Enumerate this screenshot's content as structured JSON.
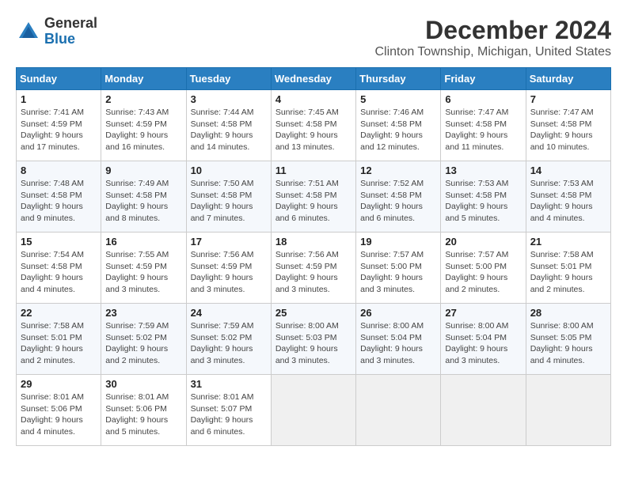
{
  "header": {
    "logo_general": "General",
    "logo_blue": "Blue",
    "month_title": "December 2024",
    "location": "Clinton Township, Michigan, United States"
  },
  "calendar": {
    "days_of_week": [
      "Sunday",
      "Monday",
      "Tuesday",
      "Wednesday",
      "Thursday",
      "Friday",
      "Saturday"
    ],
    "weeks": [
      [
        null,
        null,
        null,
        null,
        null,
        null,
        null
      ]
    ],
    "cells": [
      {
        "day": null,
        "week": 0,
        "dow": 0
      },
      {
        "day": null,
        "week": 0,
        "dow": 1
      },
      {
        "day": null,
        "week": 0,
        "dow": 2
      },
      {
        "day": null,
        "week": 0,
        "dow": 3
      },
      {
        "day": null,
        "week": 0,
        "dow": 4
      },
      {
        "day": null,
        "week": 0,
        "dow": 5
      },
      {
        "day": null,
        "week": 0,
        "dow": 6
      }
    ]
  },
  "days": [
    {
      "num": "1",
      "sunrise": "7:41 AM",
      "sunset": "4:59 PM",
      "daylight": "9 hours and 17 minutes."
    },
    {
      "num": "2",
      "sunrise": "7:43 AM",
      "sunset": "4:59 PM",
      "daylight": "9 hours and 16 minutes."
    },
    {
      "num": "3",
      "sunrise": "7:44 AM",
      "sunset": "4:58 PM",
      "daylight": "9 hours and 14 minutes."
    },
    {
      "num": "4",
      "sunrise": "7:45 AM",
      "sunset": "4:58 PM",
      "daylight": "9 hours and 13 minutes."
    },
    {
      "num": "5",
      "sunrise": "7:46 AM",
      "sunset": "4:58 PM",
      "daylight": "9 hours and 12 minutes."
    },
    {
      "num": "6",
      "sunrise": "7:47 AM",
      "sunset": "4:58 PM",
      "daylight": "9 hours and 11 minutes."
    },
    {
      "num": "7",
      "sunrise": "7:47 AM",
      "sunset": "4:58 PM",
      "daylight": "9 hours and 10 minutes."
    },
    {
      "num": "8",
      "sunrise": "7:48 AM",
      "sunset": "4:58 PM",
      "daylight": "9 hours and 9 minutes."
    },
    {
      "num": "9",
      "sunrise": "7:49 AM",
      "sunset": "4:58 PM",
      "daylight": "9 hours and 8 minutes."
    },
    {
      "num": "10",
      "sunrise": "7:50 AM",
      "sunset": "4:58 PM",
      "daylight": "9 hours and 7 minutes."
    },
    {
      "num": "11",
      "sunrise": "7:51 AM",
      "sunset": "4:58 PM",
      "daylight": "9 hours and 6 minutes."
    },
    {
      "num": "12",
      "sunrise": "7:52 AM",
      "sunset": "4:58 PM",
      "daylight": "9 hours and 6 minutes."
    },
    {
      "num": "13",
      "sunrise": "7:53 AM",
      "sunset": "4:58 PM",
      "daylight": "9 hours and 5 minutes."
    },
    {
      "num": "14",
      "sunrise": "7:53 AM",
      "sunset": "4:58 PM",
      "daylight": "9 hours and 4 minutes."
    },
    {
      "num": "15",
      "sunrise": "7:54 AM",
      "sunset": "4:58 PM",
      "daylight": "9 hours and 4 minutes."
    },
    {
      "num": "16",
      "sunrise": "7:55 AM",
      "sunset": "4:59 PM",
      "daylight": "9 hours and 3 minutes."
    },
    {
      "num": "17",
      "sunrise": "7:56 AM",
      "sunset": "4:59 PM",
      "daylight": "9 hours and 3 minutes."
    },
    {
      "num": "18",
      "sunrise": "7:56 AM",
      "sunset": "4:59 PM",
      "daylight": "9 hours and 3 minutes."
    },
    {
      "num": "19",
      "sunrise": "7:57 AM",
      "sunset": "5:00 PM",
      "daylight": "9 hours and 3 minutes."
    },
    {
      "num": "20",
      "sunrise": "7:57 AM",
      "sunset": "5:00 PM",
      "daylight": "9 hours and 2 minutes."
    },
    {
      "num": "21",
      "sunrise": "7:58 AM",
      "sunset": "5:01 PM",
      "daylight": "9 hours and 2 minutes."
    },
    {
      "num": "22",
      "sunrise": "7:58 AM",
      "sunset": "5:01 PM",
      "daylight": "9 hours and 2 minutes."
    },
    {
      "num": "23",
      "sunrise": "7:59 AM",
      "sunset": "5:02 PM",
      "daylight": "9 hours and 2 minutes."
    },
    {
      "num": "24",
      "sunrise": "7:59 AM",
      "sunset": "5:02 PM",
      "daylight": "9 hours and 3 minutes."
    },
    {
      "num": "25",
      "sunrise": "8:00 AM",
      "sunset": "5:03 PM",
      "daylight": "9 hours and 3 minutes."
    },
    {
      "num": "26",
      "sunrise": "8:00 AM",
      "sunset": "5:04 PM",
      "daylight": "9 hours and 3 minutes."
    },
    {
      "num": "27",
      "sunrise": "8:00 AM",
      "sunset": "5:04 PM",
      "daylight": "9 hours and 3 minutes."
    },
    {
      "num": "28",
      "sunrise": "8:00 AM",
      "sunset": "5:05 PM",
      "daylight": "9 hours and 4 minutes."
    },
    {
      "num": "29",
      "sunrise": "8:01 AM",
      "sunset": "5:06 PM",
      "daylight": "9 hours and 4 minutes."
    },
    {
      "num": "30",
      "sunrise": "8:01 AM",
      "sunset": "5:06 PM",
      "daylight": "9 hours and 5 minutes."
    },
    {
      "num": "31",
      "sunrise": "8:01 AM",
      "sunset": "5:07 PM",
      "daylight": "9 hours and 6 minutes."
    }
  ],
  "labels": {
    "sunrise": "Sunrise:",
    "sunset": "Sunset:",
    "daylight": "Daylight:"
  }
}
